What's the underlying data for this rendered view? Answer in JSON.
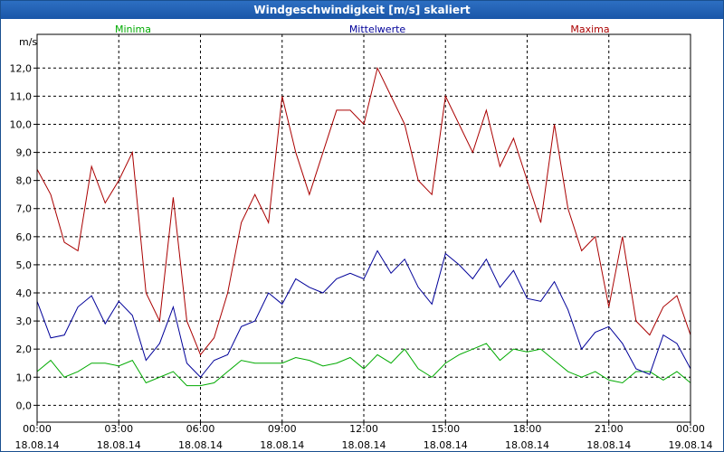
{
  "window": {
    "title": "Windgeschwindigkeit [m/s] skaliert"
  },
  "colors": {
    "minima": "#00aa00",
    "mittelwerte": "#000099",
    "maxima": "#aa0000",
    "titlebar": "#1a56a8"
  },
  "chart_data": {
    "type": "line",
    "title": "Windgeschwindigkeit [m/s] skaliert",
    "ylabel": "m/s",
    "xlabel": "",
    "ylim": [
      -0.6,
      13.2
    ],
    "xlim": [
      0,
      24
    ],
    "grid": true,
    "legend_position": "top",
    "y_ticks": [
      "0,0",
      "1,0",
      "2,0",
      "3,0",
      "4,0",
      "5,0",
      "6,0",
      "7,0",
      "8,0",
      "9,0",
      "10,0",
      "11,0",
      "12,0"
    ],
    "x_ticks": [
      {
        "time": "00:00",
        "date": "18.08.14"
      },
      {
        "time": "03:00",
        "date": "18.08.14"
      },
      {
        "time": "06:00",
        "date": "18.08.14"
      },
      {
        "time": "09:00",
        "date": "18.08.14"
      },
      {
        "time": "12:00",
        "date": "18.08.14"
      },
      {
        "time": "15:00",
        "date": "18.08.14"
      },
      {
        "time": "18:00",
        "date": "18.08.14"
      },
      {
        "time": "21:00",
        "date": "18.08.14"
      },
      {
        "time": "00:00",
        "date": "19.08.14"
      }
    ],
    "x_hours": [
      0,
      0.5,
      1,
      1.5,
      2,
      2.5,
      3,
      3.5,
      4,
      4.5,
      5,
      5.5,
      6,
      6.5,
      7,
      7.5,
      8,
      8.5,
      9,
      9.5,
      10,
      10.5,
      11,
      11.5,
      12,
      12.5,
      13,
      13.5,
      14,
      14.5,
      15,
      15.5,
      16,
      16.5,
      17,
      17.5,
      18,
      18.5,
      19,
      19.5,
      20,
      20.5,
      21,
      21.5,
      22,
      22.5,
      23,
      23.5,
      24
    ],
    "series": [
      {
        "name": "Minima",
        "color": "#00aa00",
        "values": [
          1.2,
          1.6,
          1.0,
          1.2,
          1.5,
          1.5,
          1.4,
          1.6,
          0.8,
          1.0,
          1.2,
          0.7,
          0.7,
          0.8,
          1.2,
          1.6,
          1.5,
          1.5,
          1.5,
          1.7,
          1.6,
          1.4,
          1.5,
          1.7,
          1.3,
          1.8,
          1.5,
          2.0,
          1.3,
          1.0,
          1.5,
          1.8,
          2.0,
          2.2,
          1.6,
          2.0,
          1.9,
          2.0,
          1.6,
          1.2,
          1.0,
          1.2,
          0.9,
          0.8,
          1.2,
          1.2,
          0.9,
          1.2,
          0.8
        ]
      },
      {
        "name": "Mittelwerte",
        "color": "#000099",
        "values": [
          3.7,
          2.4,
          2.5,
          3.5,
          3.9,
          2.9,
          3.7,
          3.2,
          1.6,
          2.2,
          3.5,
          1.5,
          1.0,
          1.6,
          1.8,
          2.8,
          3.0,
          4.0,
          3.6,
          4.5,
          4.2,
          4.0,
          4.5,
          4.7,
          4.5,
          5.5,
          4.7,
          5.2,
          4.2,
          3.6,
          5.4,
          5.0,
          4.5,
          5.2,
          4.2,
          4.8,
          3.8,
          3.7,
          4.4,
          3.4,
          2.0,
          2.6,
          2.8,
          2.2,
          1.3,
          1.1,
          2.5,
          2.2,
          1.3
        ]
      },
      {
        "name": "Maxima",
        "color": "#aa0000",
        "values": [
          8.4,
          7.5,
          5.8,
          5.5,
          8.5,
          7.2,
          8.0,
          9.0,
          4.0,
          3.0,
          7.4,
          3.0,
          1.8,
          2.4,
          4.0,
          6.5,
          7.5,
          6.5,
          11.0,
          9.0,
          7.5,
          9.0,
          10.5,
          10.5,
          10.0,
          12.0,
          11.0,
          10.0,
          8.0,
          7.5,
          11.0,
          10.0,
          9.0,
          10.5,
          8.5,
          9.5,
          8.0,
          6.5,
          10.0,
          7.0,
          5.5,
          6.0,
          3.5,
          6.0,
          3.0,
          2.5,
          3.5,
          3.9,
          2.5
        ]
      }
    ]
  }
}
